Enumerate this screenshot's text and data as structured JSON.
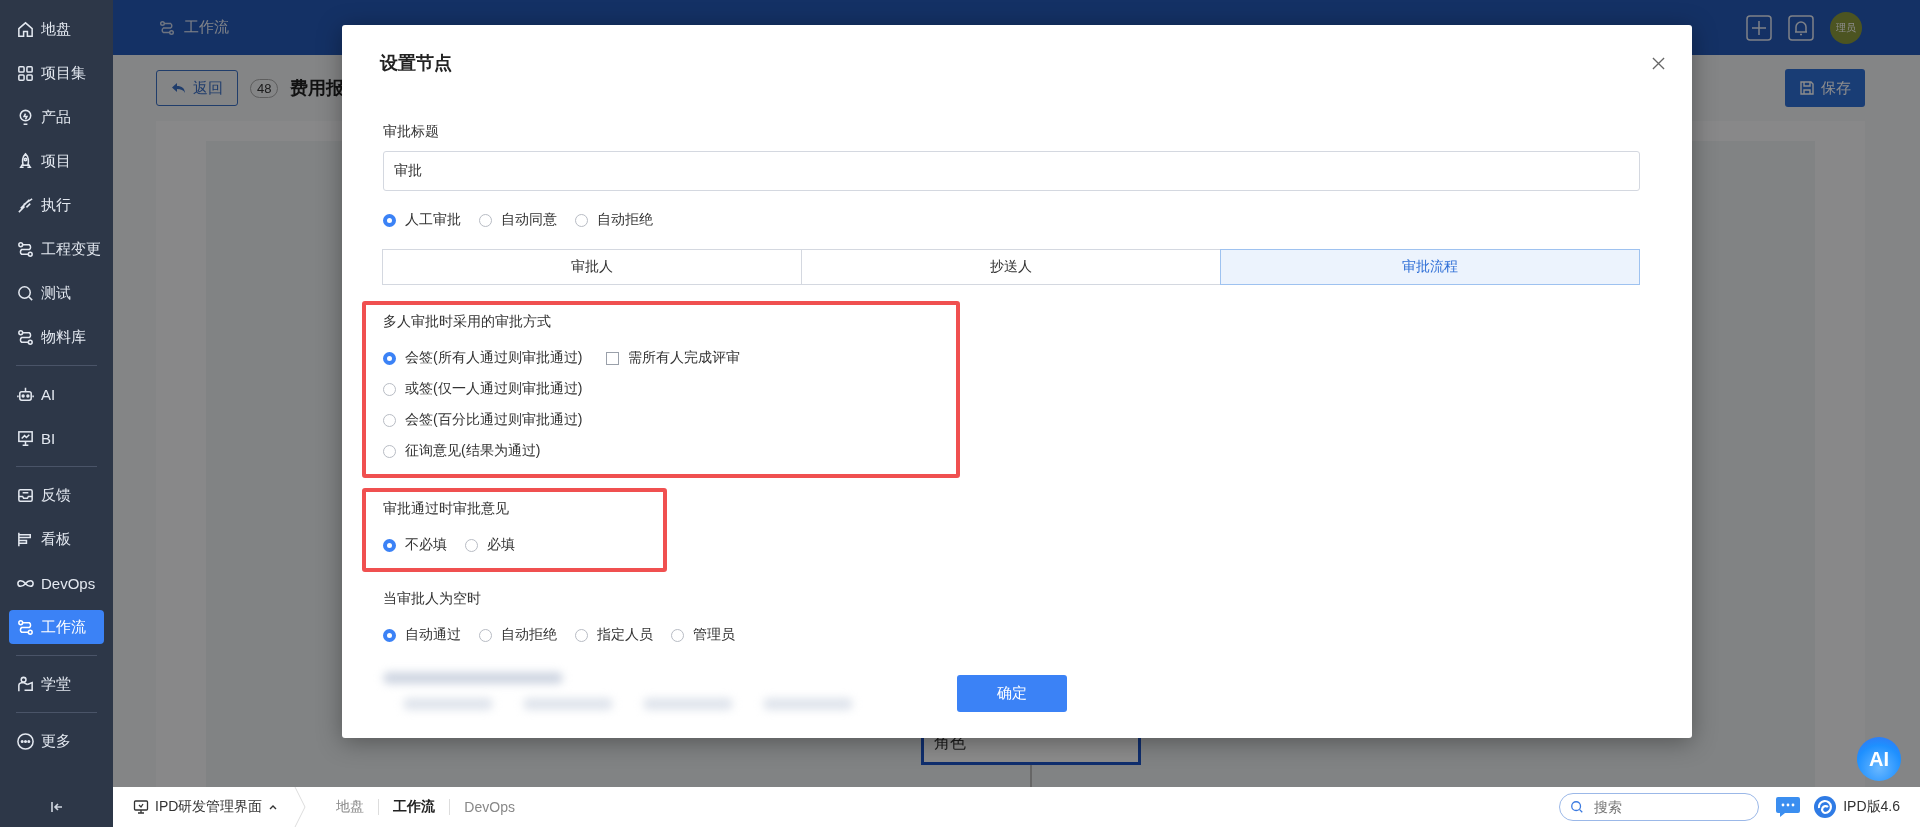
{
  "sidebar": {
    "groups": [
      {
        "items": [
          {
            "label": "地盘",
            "selected": false
          },
          {
            "label": "项目集",
            "selected": false
          },
          {
            "label": "产品",
            "selected": false
          },
          {
            "label": "项目",
            "selected": false
          },
          {
            "label": "执行",
            "selected": false
          },
          {
            "label": "工程变更",
            "selected": false
          },
          {
            "label": "测试",
            "selected": false
          },
          {
            "label": "物料库",
            "selected": false
          }
        ]
      },
      {
        "items": [
          {
            "label": "AI",
            "selected": false
          },
          {
            "label": "BI",
            "selected": false
          }
        ]
      },
      {
        "items": [
          {
            "label": "反馈",
            "selected": false
          },
          {
            "label": "看板",
            "selected": false
          },
          {
            "label": "DevOps",
            "selected": false
          },
          {
            "label": "工作流",
            "selected": true
          }
        ]
      },
      {
        "items": [
          {
            "label": "学堂",
            "selected": false
          }
        ]
      },
      {
        "items": [
          {
            "label": "更多",
            "selected": false
          }
        ]
      }
    ]
  },
  "top_bar": {
    "breadcrumb": "工作流",
    "avatar": "理员"
  },
  "page": {
    "back_button": "返回",
    "count": "48",
    "title": "费用报",
    "save_button": "保存",
    "node_label": "角色"
  },
  "modal": {
    "title": "设置节点",
    "title_field": {
      "label": "审批标题",
      "value": "审批"
    },
    "approval_type": [
      {
        "label": "人工审批",
        "selected": true
      },
      {
        "label": "自动同意",
        "selected": false
      },
      {
        "label": "自动拒绝",
        "selected": false
      }
    ],
    "tabs": [
      {
        "label": "审批人",
        "selected": false
      },
      {
        "label": "抄送人",
        "selected": false
      },
      {
        "label": "审批流程",
        "selected": true
      }
    ],
    "sections": [
      {
        "label": "多人审批时采用的审批方式",
        "highlighted": true,
        "kind": "stacked",
        "options": [
          {
            "label": "会签(所有人通过则审批通过)",
            "selected": true,
            "checkbox": {
              "label": "需所有人完成评审",
              "checked": false
            }
          },
          {
            "label": "或签(仅一人通过则审批通过)",
            "selected": false
          },
          {
            "label": "会签(百分比通过则审批通过)",
            "selected": false
          },
          {
            "label": "征询意见(结果为通过)",
            "selected": false
          }
        ]
      },
      {
        "label": "审批通过时审批意见",
        "highlighted": true,
        "kind": "inline",
        "options": [
          {
            "label": "不必填",
            "selected": true
          },
          {
            "label": "必填",
            "selected": false
          }
        ]
      },
      {
        "label": "当审批人为空时",
        "kind": "inline",
        "options": [
          {
            "label": "自动通过",
            "selected": true
          },
          {
            "label": "自动拒绝",
            "selected": false
          },
          {
            "label": "指定人员",
            "selected": false
          },
          {
            "label": "管理员",
            "selected": false
          }
        ]
      }
    ],
    "confirm_button": "确定"
  },
  "bottom_bar": {
    "workspace": "IPD研发管理界面",
    "tabs": [
      {
        "label": "地盘",
        "selected": false
      },
      {
        "label": "工作流",
        "selected": true
      },
      {
        "label": "DevOps",
        "selected": false
      }
    ],
    "search": {
      "placeholder": "搜索"
    },
    "version": "IPD版4.6"
  },
  "ai_button": "AI"
}
